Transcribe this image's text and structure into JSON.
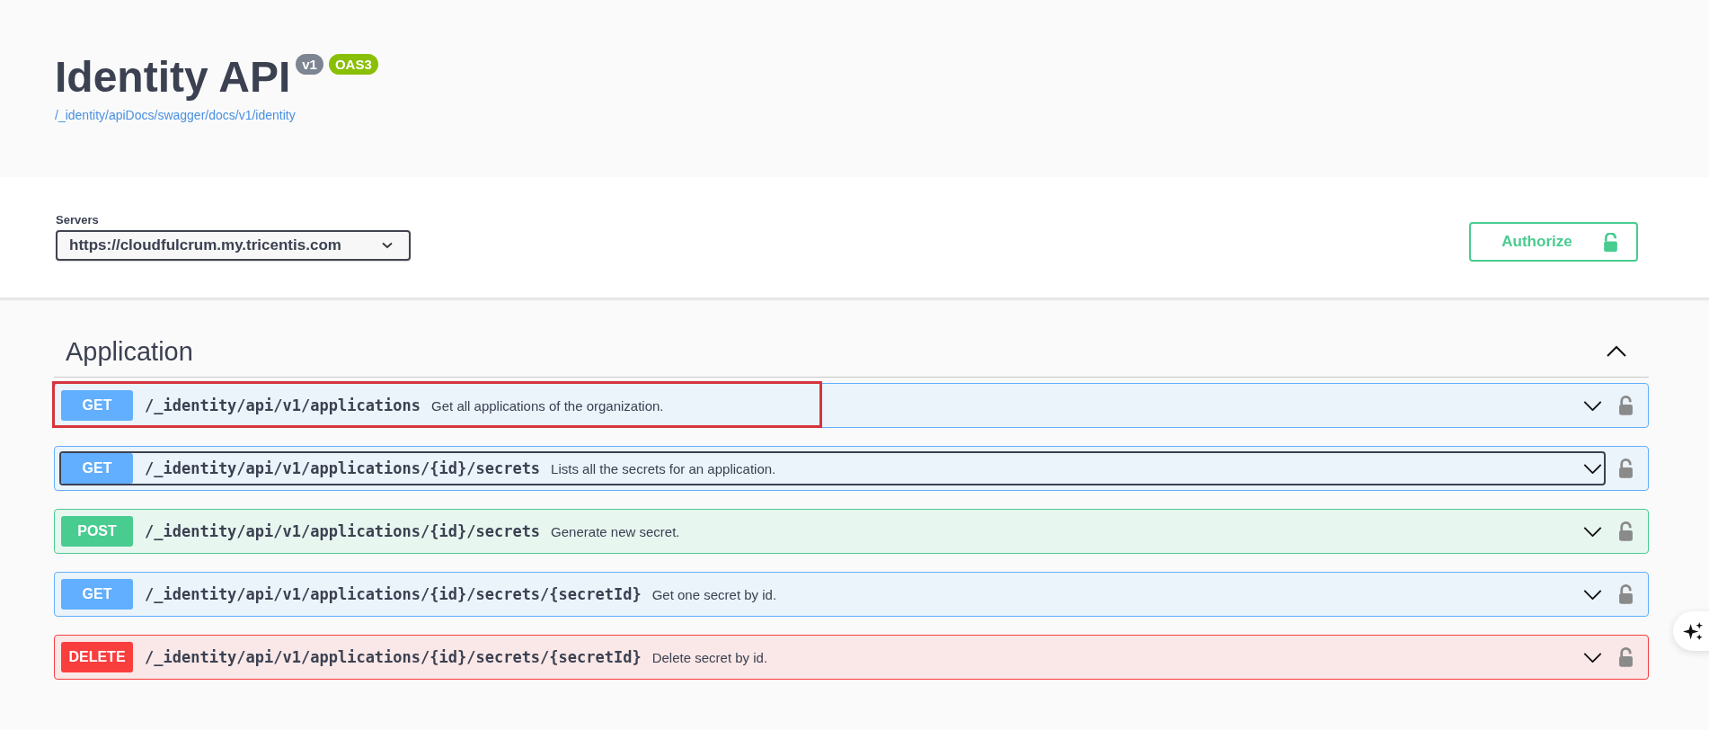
{
  "info": {
    "title": "Identity API",
    "version_badge": "v1",
    "spec_badge": "OAS3",
    "spec_link": "/_identity/apiDocs/swagger/docs/v1/identity"
  },
  "servers": {
    "label": "Servers",
    "value": "https://cloudfulcrum.my.tricentis.com"
  },
  "authorize_button": "Authorize",
  "tag": {
    "name": "Application",
    "expanded": true
  },
  "operations": [
    {
      "kind": "get",
      "method": "GET",
      "path": "/_identity/api/v1/applications",
      "summary": "Get all applications of the organization.",
      "highlighted": true,
      "focused": false
    },
    {
      "kind": "get",
      "method": "GET",
      "path": "/_identity/api/v1/applications/{id}/secrets",
      "summary": "Lists all the secrets for an application.",
      "highlighted": false,
      "focused": true
    },
    {
      "kind": "post",
      "method": "POST",
      "path": "/_identity/api/v1/applications/{id}/secrets",
      "summary": "Generate new secret.",
      "highlighted": false,
      "focused": false
    },
    {
      "kind": "get",
      "method": "GET",
      "path": "/_identity/api/v1/applications/{id}/secrets/{secretId}",
      "summary": "Get one secret by id.",
      "highlighted": false,
      "focused": false
    },
    {
      "kind": "delete",
      "method": "DELETE",
      "path": "/_identity/api/v1/applications/{id}/secrets/{secretId}",
      "summary": "Delete secret by id.",
      "highlighted": false,
      "focused": false
    }
  ]
}
